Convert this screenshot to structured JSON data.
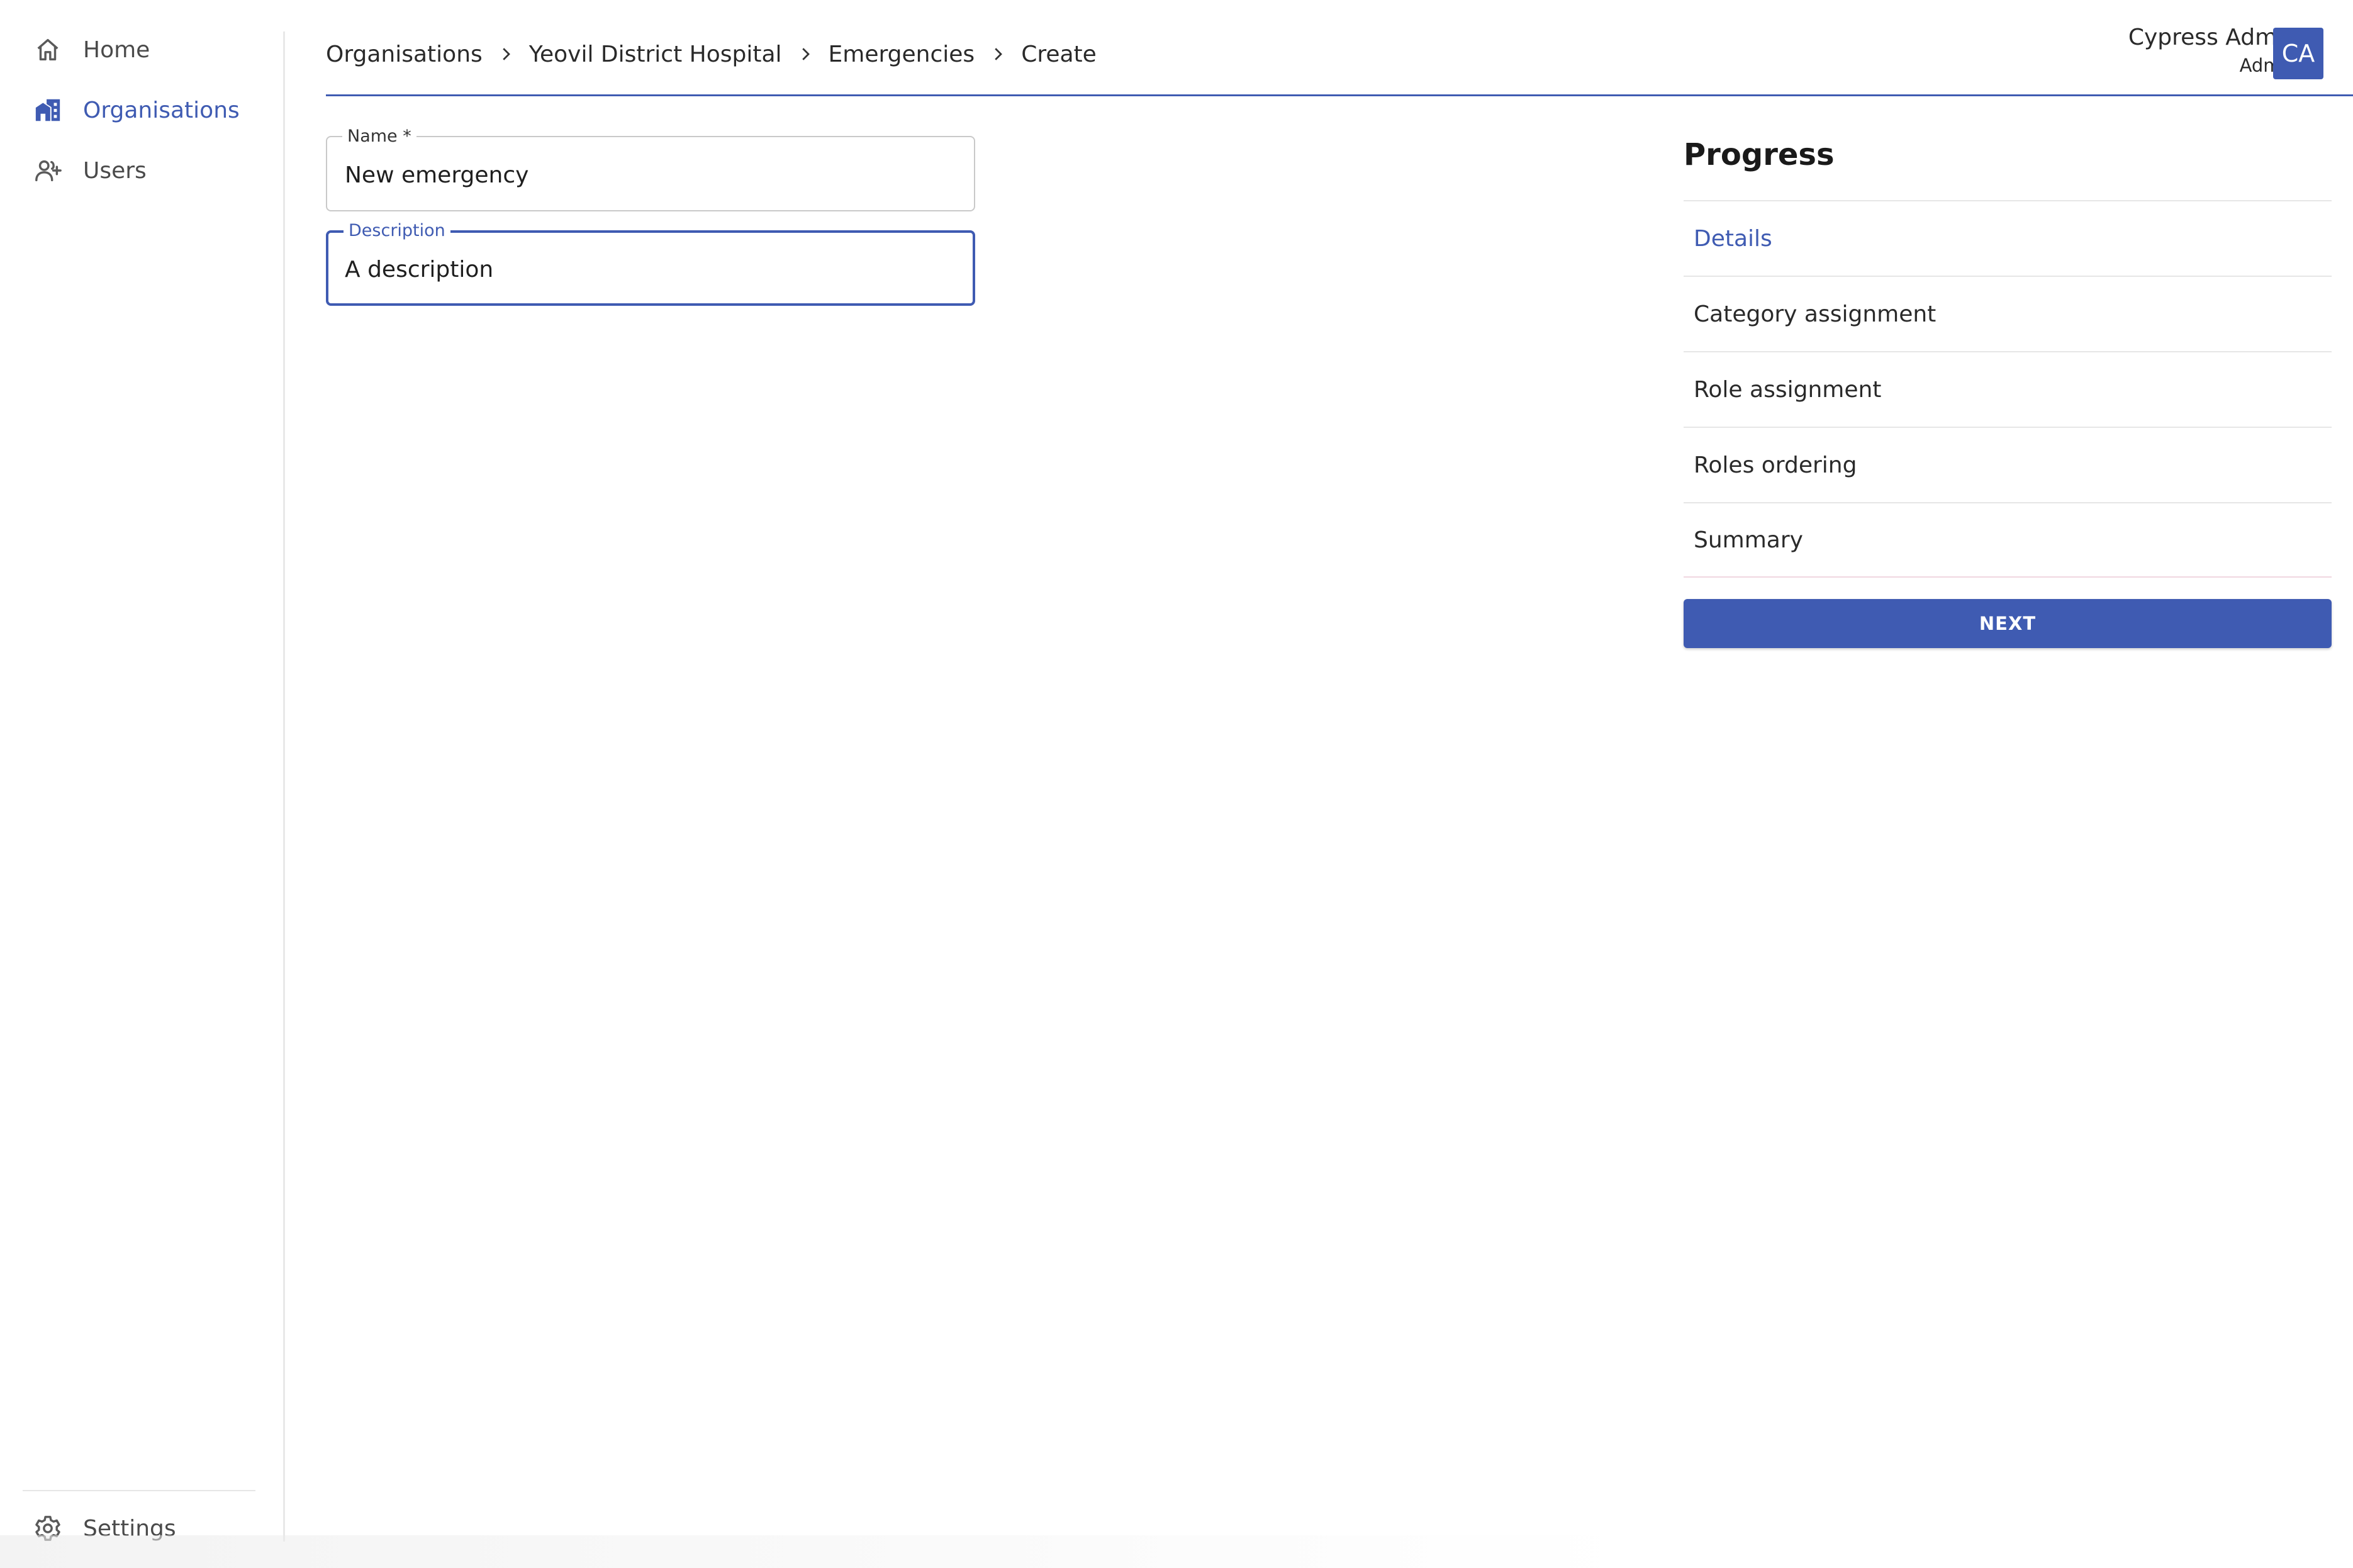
{
  "sidebar": {
    "items": [
      {
        "label": "Home",
        "icon": "home-icon",
        "active": false
      },
      {
        "label": "Organisations",
        "icon": "organisations-icon",
        "active": true
      },
      {
        "label": "Users",
        "icon": "users-icon",
        "active": false
      }
    ],
    "settings": {
      "label": "Settings",
      "icon": "gear-icon"
    }
  },
  "breadcrumb": [
    "Organisations",
    "Yeovil District Hospital",
    "Emergencies",
    "Create"
  ],
  "user": {
    "name": "Cypress Admin",
    "role": "Admin",
    "initials": "CA"
  },
  "form": {
    "name": {
      "label": "Name *",
      "value": "New emergency"
    },
    "description": {
      "label": "Description",
      "value": "A description"
    }
  },
  "progress": {
    "title": "Progress",
    "steps": [
      "Details",
      "Category assignment",
      "Role assignment",
      "Roles ordering",
      "Summary"
    ],
    "active_step": "Details"
  },
  "actions": {
    "next_label": "NEXT"
  },
  "colors": {
    "accent": "#3f5bb2",
    "text": "#2a2a2a",
    "divider": "#e6e6e6"
  }
}
